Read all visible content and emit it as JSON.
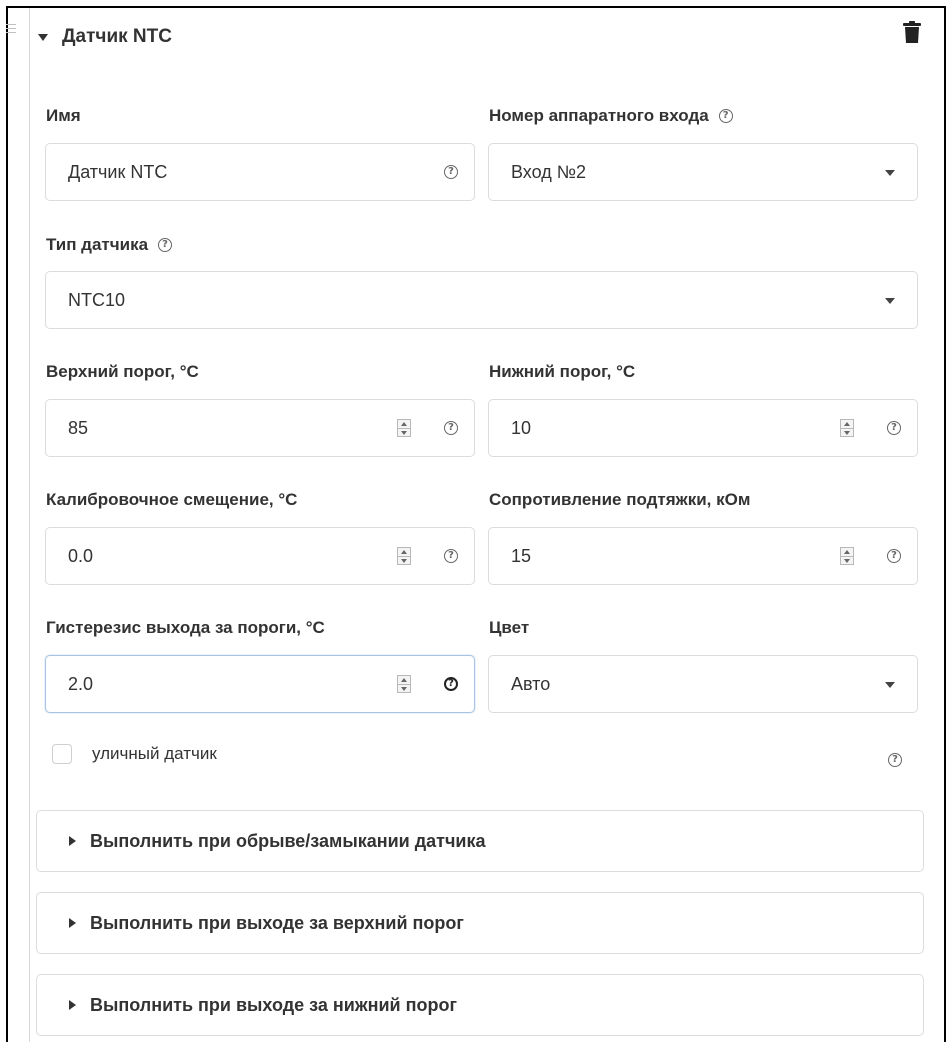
{
  "header": {
    "title": "Датчик NTC"
  },
  "fields": {
    "name": {
      "label": "Имя",
      "value": "Датчик NTC"
    },
    "hw_input": {
      "label": "Номер аппаратного входа",
      "value": "Вход №2"
    },
    "sensor_type": {
      "label": "Тип датчика",
      "value": "NTC10"
    },
    "upper_threshold": {
      "label": "Верхний порог, °C",
      "value": "85"
    },
    "lower_threshold": {
      "label": "Нижний порог, °C",
      "value": "10"
    },
    "calibration_offset": {
      "label": "Калибровочное смещение, °C",
      "value": "0.0"
    },
    "pullup_resistance": {
      "label": "Сопротивление подтяжки, кОм",
      "value": "15"
    },
    "hysteresis": {
      "label": "Гистерезис выхода за пороги, °C",
      "value": "2.0"
    },
    "color": {
      "label": "Цвет",
      "value": "Авто"
    }
  },
  "outdoor_sensor": {
    "label": "уличный датчик",
    "checked": false
  },
  "panels": [
    {
      "title": "Выполнить при обрыве/замыкании датчика"
    },
    {
      "title": "Выполнить при выходе за верхний порог"
    },
    {
      "title": "Выполнить при выходе за нижний порог"
    }
  ],
  "icons": {
    "help": "question-circle-icon",
    "delete": "trash-icon",
    "drag": "drag-handle-icon",
    "collapse": "caret-down-icon",
    "expand": "caret-right-icon",
    "dropdown": "caret-down-icon",
    "stepper": "spinner-icon"
  },
  "colors": {
    "focus_border": "#a8c3e6",
    "text": "#333333",
    "border": "#dcdcdc"
  }
}
